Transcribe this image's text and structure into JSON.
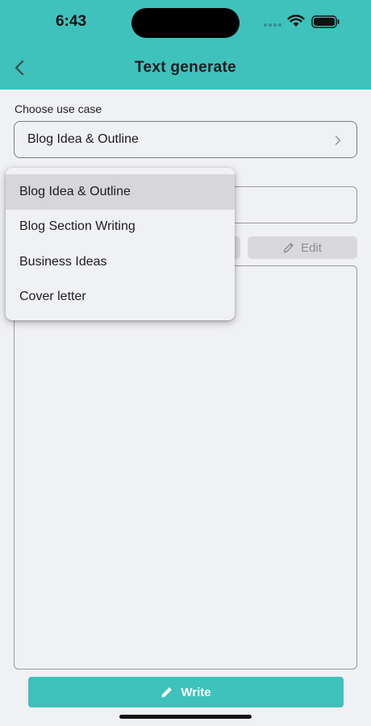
{
  "status_bar": {
    "time": "6:43"
  },
  "header": {
    "title": "Text generate",
    "back_icon": "chevron-left-icon",
    "background": "#3fc1bc"
  },
  "use_case": {
    "label": "Choose use case",
    "selected": "Blog Idea & Outline",
    "icon": "chevron-right-icon"
  },
  "actions": {
    "edit_label": "Edit",
    "edit_icon": "pencil-icon"
  },
  "dropdown": {
    "items": [
      {
        "label": "Blog Idea & Outline",
        "selected": true
      },
      {
        "label": "Blog Section Writing"
      },
      {
        "label": "Business Ideas"
      },
      {
        "label": "Cover letter"
      }
    ]
  },
  "footer": {
    "write_label": "Write",
    "write_icon": "pencil-icon",
    "accent": "#3fc1bc"
  }
}
